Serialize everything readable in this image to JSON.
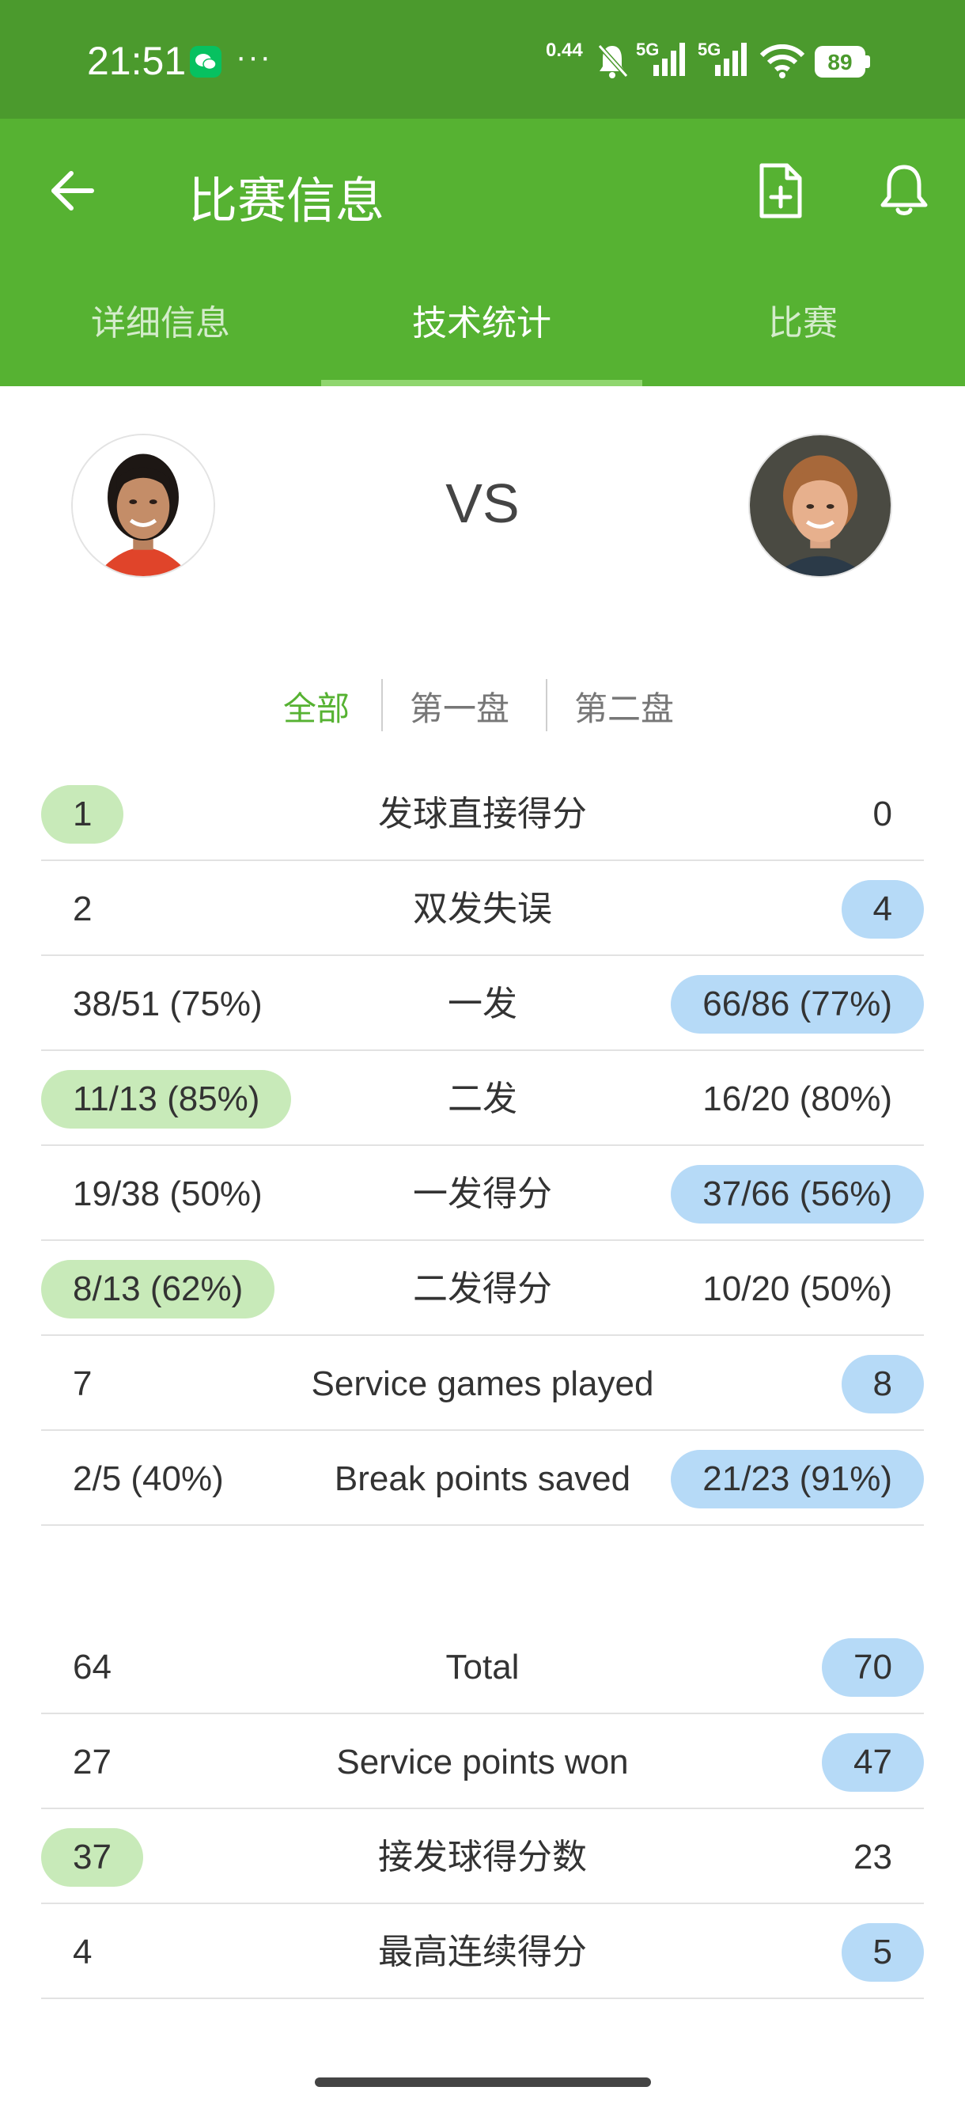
{
  "status_bar": {
    "time": "21:51",
    "more": "···",
    "net_speed": "0.44",
    "signal1": "5G",
    "signal2": "5G",
    "battery": "89"
  },
  "header": {
    "title": "比赛信息"
  },
  "tabs": [
    {
      "label": "详细信息",
      "active": false
    },
    {
      "label": "技术统计",
      "active": true
    },
    {
      "label": "比赛",
      "active": false
    }
  ],
  "match": {
    "vs_label": "VS"
  },
  "set_filter": [
    {
      "label": "全部",
      "active": true
    },
    {
      "label": "第一盘",
      "active": false
    },
    {
      "label": "第二盘",
      "active": false
    }
  ],
  "stats_group1": [
    {
      "left": "1",
      "label": "发球直接得分",
      "right": "0",
      "leader": "left"
    },
    {
      "left": "2",
      "label": "双发失误",
      "right": "4",
      "leader": "right"
    },
    {
      "left": "38/51 (75%)",
      "label": "一发",
      "right": "66/86 (77%)",
      "leader": "right"
    },
    {
      "left": "11/13 (85%)",
      "label": "二发",
      "right": "16/20 (80%)",
      "leader": "left"
    },
    {
      "left": "19/38 (50%)",
      "label": "一发得分",
      "right": "37/66 (56%)",
      "leader": "right"
    },
    {
      "left": "8/13 (62%)",
      "label": "二发得分",
      "right": "10/20 (50%)",
      "leader": "left"
    },
    {
      "left": "7",
      "label": "Service games played",
      "right": "8",
      "leader": "right"
    },
    {
      "left": "2/5 (40%)",
      "label": "Break points saved",
      "right": "21/23 (91%)",
      "leader": "right"
    }
  ],
  "stats_group2": [
    {
      "left": "64",
      "label": "Total",
      "right": "70",
      "leader": "right"
    },
    {
      "left": "27",
      "label": "Service points won",
      "right": "47",
      "leader": "right"
    },
    {
      "left": "37",
      "label": "接发球得分数",
      "right": "23",
      "leader": "left"
    },
    {
      "left": "4",
      "label": "最高连续得分",
      "right": "5",
      "leader": "right"
    }
  ],
  "colors": {
    "status_bar": "#4b9a2d",
    "app_bar": "#56b232",
    "left_highlight": "#c8eab9",
    "right_highlight": "#b6daf7"
  },
  "icons": [
    "back-arrow-icon",
    "add-document-icon",
    "bell-icon",
    "wechat-icon",
    "mute-icon",
    "wifi-icon",
    "battery-icon"
  ]
}
